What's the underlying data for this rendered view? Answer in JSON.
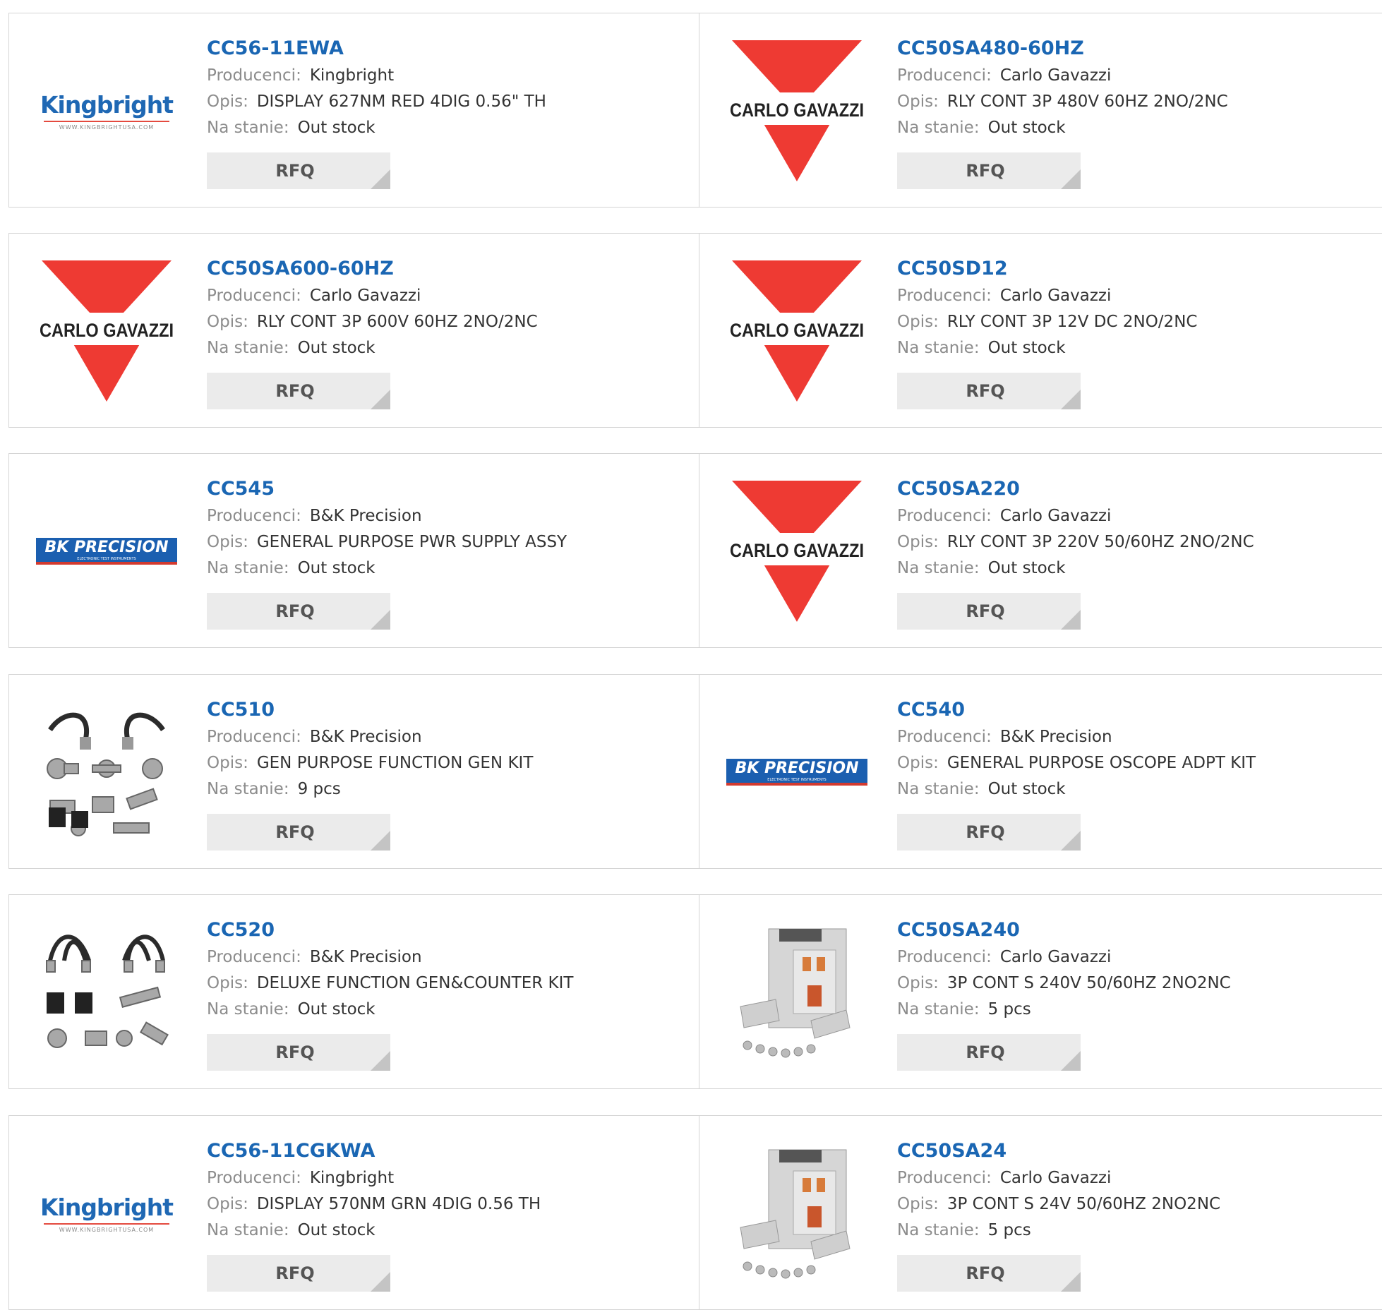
{
  "labels": {
    "manufacturer": "Producenci:",
    "description": "Opis:",
    "stock": "Na stanie:",
    "rfq": "RFQ"
  },
  "logo_text": {
    "kingbright": "Kingbright",
    "kingbright_url": "WWW.KINGBRIGHTUSA.COM",
    "carlo_gavazzi": "CARLO GAVAZZI",
    "bk_precision": "BK PRECISION",
    "bk_precision_sub": "ELECTRONIC TEST INSTRUMENTS"
  },
  "products": [
    {
      "part": "CC56-11EWA",
      "manufacturer": "Kingbright",
      "description": "DISPLAY 627NM RED 4DIG 0.56\" TH",
      "stock": "Out stock",
      "logo": "kingbright-logo"
    },
    {
      "part": "CC50SA480-60HZ",
      "manufacturer": "Carlo Gavazzi",
      "description": "RLY CONT 3P 480V 60HZ 2NO/2NC",
      "stock": "Out stock",
      "logo": "carlo-gavazzi-logo"
    },
    {
      "part": "CC50SA600-60HZ",
      "manufacturer": "Carlo Gavazzi",
      "description": "RLY CONT 3P 600V 60HZ 2NO/2NC",
      "stock": "Out stock",
      "logo": "carlo-gavazzi-logo"
    },
    {
      "part": "CC50SD12",
      "manufacturer": "Carlo Gavazzi",
      "description": "RLY CONT 3P 12V DC 2NO/2NC",
      "stock": "Out stock",
      "logo": "carlo-gavazzi-logo"
    },
    {
      "part": "CC545",
      "manufacturer": "B&K Precision",
      "description": "GENERAL PURPOSE PWR SUPPLY ASSY",
      "stock": "Out stock",
      "logo": "bk-precision-logo"
    },
    {
      "part": "CC50SA220",
      "manufacturer": "Carlo Gavazzi",
      "description": "RLY CONT 3P 220V 50/60HZ 2NO/2NC",
      "stock": "Out stock",
      "logo": "carlo-gavazzi-logo"
    },
    {
      "part": "CC510",
      "manufacturer": "B&K Precision",
      "description": "GEN PURPOSE FUNCTION GEN KIT",
      "stock": "9 pcs",
      "logo": "bnc-adapter-kit-photo"
    },
    {
      "part": "CC540",
      "manufacturer": "B&K Precision",
      "description": "GENERAL PURPOSE OSCOPE ADPT KIT",
      "stock": "Out stock",
      "logo": "bk-precision-logo"
    },
    {
      "part": "CC520",
      "manufacturer": "B&K Precision",
      "description": "DELUXE FUNCTION GEN&COUNTER KIT",
      "stock": "Out stock",
      "logo": "bnc-cable-kit-photo"
    },
    {
      "part": "CC50SA240",
      "manufacturer": "Carlo Gavazzi",
      "description": "3P CONT S 240V 50/60HZ 2NO2NC",
      "stock": "5 pcs",
      "logo": "contactor-photo"
    },
    {
      "part": "CC56-11CGKWA",
      "manufacturer": "Kingbright",
      "description": "DISPLAY 570NM GRN 4DIG 0.56 TH",
      "stock": "Out stock",
      "logo": "kingbright-logo"
    },
    {
      "part": "CC50SA24",
      "manufacturer": "Carlo Gavazzi",
      "description": "3P CONT S 24V 50/60HZ 2NO2NC",
      "stock": "5 pcs",
      "logo": "contactor-photo"
    }
  ],
  "colors": {
    "part_link": "#1a66b3",
    "label_gray": "#8c8c8c",
    "carlo_red": "#ee3a33",
    "kingbright_blue": "#1f68b4",
    "bk_blue": "#1b5fb0",
    "rfq_bg": "#ebebeb"
  }
}
